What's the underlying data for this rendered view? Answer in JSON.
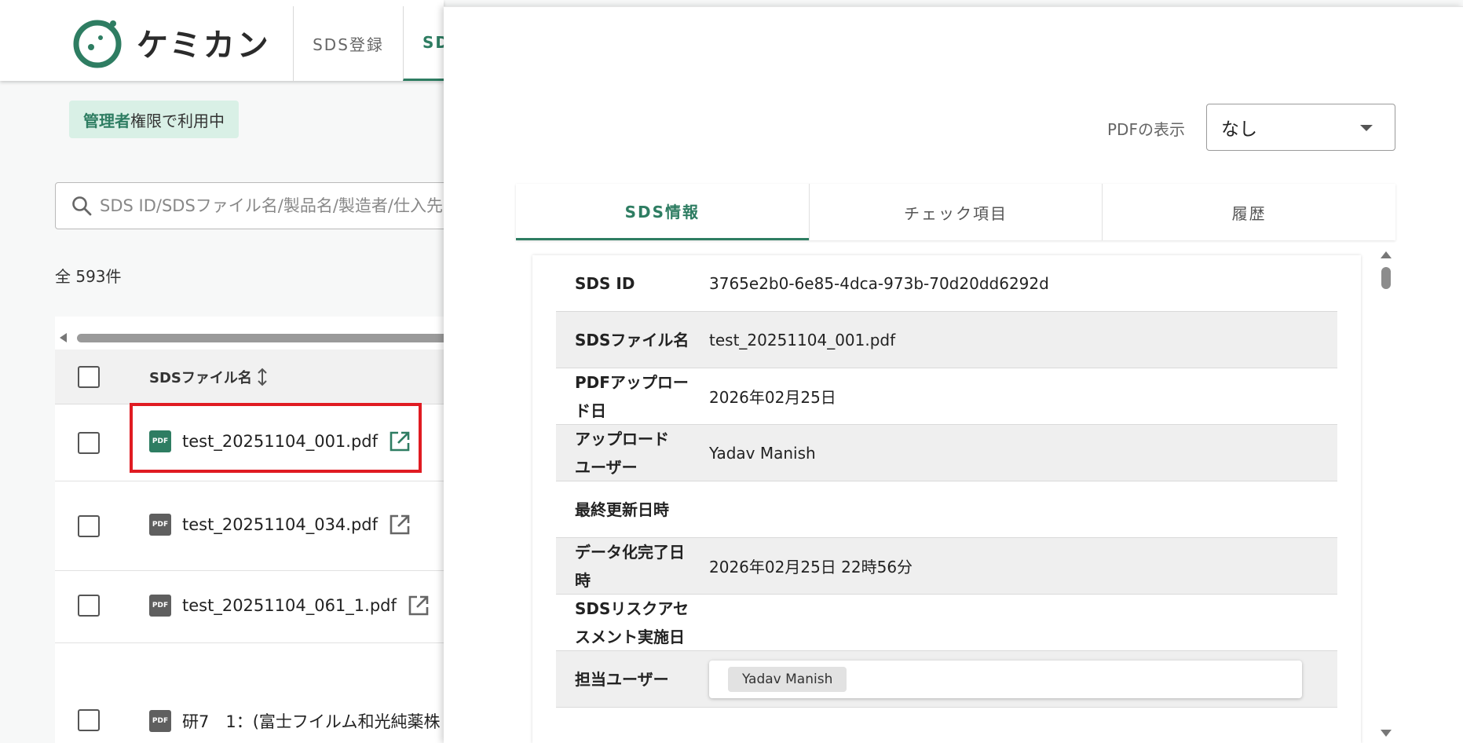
{
  "app": {
    "logo_text": "ケミカン",
    "nav_tabs": [
      "SDS登録",
      "SD"
    ]
  },
  "admin_badge": {
    "strong": "管理者",
    "rest": "権限で利用中"
  },
  "search": {
    "placeholder": "SDS ID/SDSファイル名/製品名/製造者/仕入先"
  },
  "count_text": "全 593件",
  "table": {
    "column_header": "SDSファイル名",
    "rows": [
      {
        "file": "test_20251104_001.pdf",
        "icon": "PDF"
      },
      {
        "file": "test_20251104_034.pdf",
        "icon": "PDF"
      },
      {
        "file": "test_20251104_061_1.pdf",
        "icon": "PDF"
      },
      {
        "file": "研7　1：(富士フイルム和光純薬株",
        "icon": "PDF"
      }
    ]
  },
  "drawer": {
    "pdf_display_label": "PDFの表示",
    "pdf_display_value": "なし",
    "tabs": [
      "SDS情報",
      "チェック項目",
      "履歴"
    ],
    "info": [
      {
        "label": "SDS ID",
        "value": "3765e2b0-6e85-4dca-973b-70d20dd6292d"
      },
      {
        "label": "SDSファイル名",
        "value": "test_20251104_001.pdf"
      },
      {
        "label_line1": "PDFアップロー",
        "label_line2": "ド日",
        "value": "2026年02月25日"
      },
      {
        "label_line1": "アップロード",
        "label_line2": "ユーザー",
        "value": "Yadav Manish"
      },
      {
        "label": "最終更新日時",
        "value": ""
      },
      {
        "label_line1": "データ化完了日",
        "label_line2": "時",
        "value": "2026年02月25日 22時56分"
      },
      {
        "label_line1": "SDSリスクアセ",
        "label_line2": "スメント実施日",
        "value": ""
      },
      {
        "label": "担当ユーザー",
        "chip": "Yadav Manish"
      }
    ]
  },
  "colors": {
    "accent": "#2e7d62",
    "highlight": "#e01b22",
    "badge_bg": "#d9f0e6"
  }
}
